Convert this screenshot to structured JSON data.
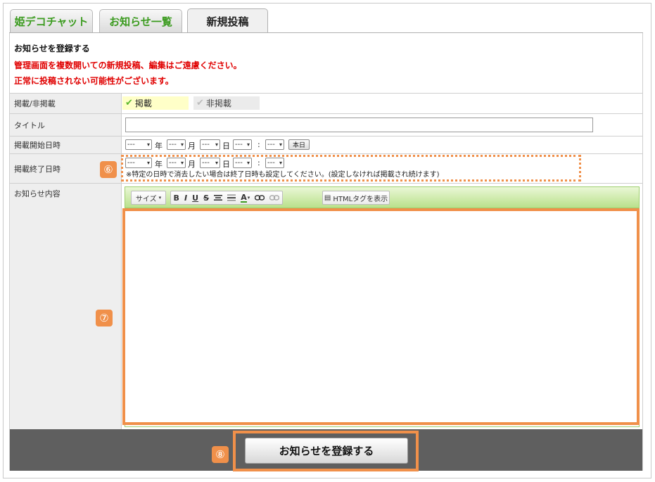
{
  "tabs": [
    {
      "label": "姫デコチャット"
    },
    {
      "label": "お知らせ一覧"
    },
    {
      "label": "新規投稿"
    }
  ],
  "notice": {
    "heading": "お知らせを登録する",
    "warning1": "管理画面を複数開いての新規投稿、編集はご遠慮ください。",
    "warning2": "正常に投稿されない可能性がございます。"
  },
  "form": {
    "publish": {
      "label": "掲載/非掲載",
      "on": "掲載",
      "off": "非掲載"
    },
    "title": {
      "label": "タイトル",
      "value": ""
    },
    "start": {
      "label": "掲載開始日時",
      "select": "---",
      "year": "年",
      "month": "月",
      "day": "日",
      "colon": ":",
      "today": "本日"
    },
    "end": {
      "label": "掲載終了日時",
      "select": "---",
      "year": "年",
      "month": "月",
      "day": "日",
      "colon": ":",
      "note": "※特定の日時で消去したい場合は終了日時も設定してください。(設定しなければ掲載され続けます)"
    },
    "content": {
      "label": "お知らせ内容"
    }
  },
  "toolbar": {
    "size": "サイズ",
    "bold": "B",
    "italic": "I",
    "underline": "U",
    "strike": "S",
    "color": "A",
    "html": "HTMLタグを表示"
  },
  "badges": {
    "six": "⑥",
    "seven": "⑦",
    "eight": "⑧"
  },
  "submit_label": "お知らせを登録する",
  "colors": {
    "accent_orange": "#f0904a",
    "tab_green": "#3b9b1f",
    "warning_red": "#e00000"
  }
}
